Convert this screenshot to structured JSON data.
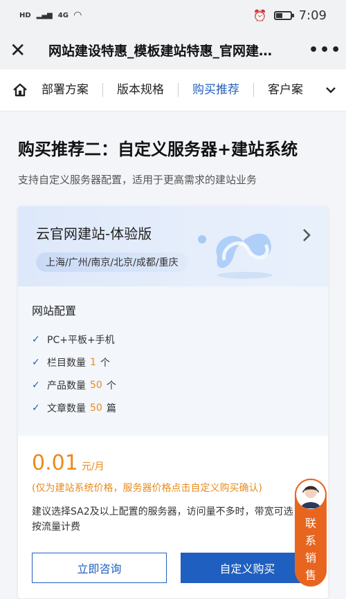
{
  "status_bar": {
    "left_text": "HD",
    "network": "4G",
    "time": "7:09"
  },
  "header": {
    "title": "网站建设特惠_模板建站特惠_官网建…",
    "close_icon": "close-icon",
    "more_icon": "more-icon"
  },
  "nav": {
    "tabs": [
      {
        "label": "部署方案"
      },
      {
        "label": "版本规格"
      },
      {
        "label": "购买推荐"
      },
      {
        "label": "客户案"
      }
    ],
    "active_index": 2
  },
  "section": {
    "title": "购买推荐二：自定义服务器+建站系统",
    "subtitle": "支持自定义服务器配置，适用于更高需求的建站业务"
  },
  "card": {
    "product_name": "云官网建站-体验版",
    "regions": "上海/广州/南京/北京/成都/重庆",
    "config_title": "网站配置",
    "config_items": [
      {
        "prefix": "PC+平板+手机",
        "value": "",
        "suffix": ""
      },
      {
        "prefix": "栏目数量",
        "value": "1",
        "suffix": "个"
      },
      {
        "prefix": "产品数量",
        "value": "50",
        "suffix": "个"
      },
      {
        "prefix": "文章数量",
        "value": "50",
        "suffix": "篇"
      }
    ],
    "price": "0.01",
    "price_unit": "元/月",
    "price_note": "(仅为建站系统价格，服务器价格点击自定义购买确认)",
    "advice": "建议选择SA2及以上配置的服务器，访问量不多时，带宽可选按流量计费",
    "consult_label": "立即咨询",
    "buy_label": "自定义购买"
  },
  "sales_widget": {
    "label": "联系销售"
  },
  "colors": {
    "accent": "#1f5fbf",
    "highlight": "#e98b1d",
    "sales": "#e8651f"
  }
}
